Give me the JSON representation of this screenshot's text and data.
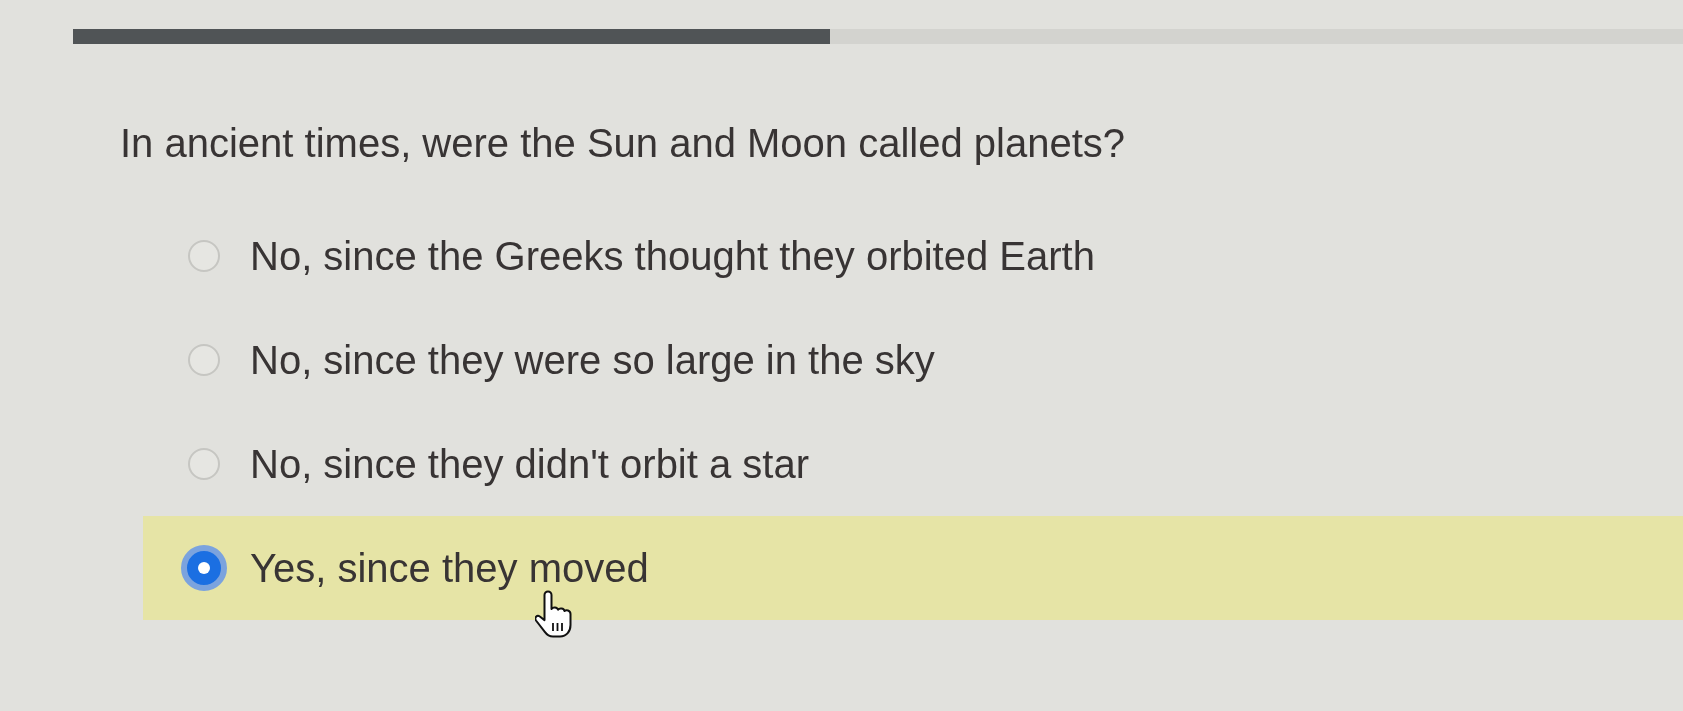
{
  "progress": {
    "level": 0.47
  },
  "question": "In ancient times, were the Sun and Moon called planets?",
  "options": [
    {
      "label": "No, since the Greeks thought they orbited Earth",
      "selected": false
    },
    {
      "label": "No, since they were so large in the sky",
      "selected": false
    },
    {
      "label": "No, since they didn't orbit a star",
      "selected": false
    },
    {
      "label": "Yes, since they moved",
      "selected": true
    }
  ]
}
